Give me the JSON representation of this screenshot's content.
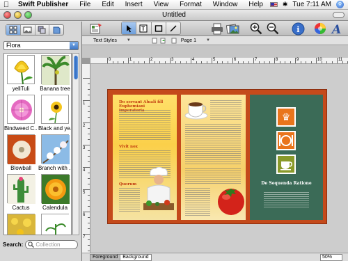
{
  "menubar": {
    "app": "Swift Publisher",
    "items": [
      "File",
      "Edit",
      "Insert",
      "View",
      "Format",
      "Window",
      "Help"
    ],
    "clock": "Tue 7:11 AM"
  },
  "window": {
    "title": "Untitled"
  },
  "subtoolbar": {
    "text_styles": "Text Styles",
    "page": "Page 1"
  },
  "leftpanel": {
    "category": "Flora",
    "clips": [
      {
        "label": "yellTuli"
      },
      {
        "label": "Banana tree"
      },
      {
        "label": "Bindweed C..."
      },
      {
        "label": "Black and ye..."
      },
      {
        "label": "Blowball"
      },
      {
        "label": "Branch with ..."
      },
      {
        "label": "Cactus"
      },
      {
        "label": "Calendula"
      }
    ],
    "search_label": "Search:",
    "search_placeholder": "Collection"
  },
  "ruler": {
    "top": [
      "0",
      "1",
      "2",
      "3",
      "4",
      "5",
      "6",
      "7",
      "8",
      "9",
      "10",
      "11"
    ],
    "left": [
      "1",
      "2",
      "3",
      "4",
      "5",
      "6",
      "7"
    ]
  },
  "brochure": {
    "p1_heading1": "Do servant Aluali fill Euphemiani imperatoria",
    "p1_heading2": "Vivit nox",
    "p1_heading3": "Quorum",
    "p3_title": "De Sequenda Ratione"
  },
  "bottombar": {
    "tabs": [
      "Foreground",
      "Background"
    ],
    "zoom": "50%"
  },
  "colors": {
    "brochure_border": "#c44a1b",
    "panel_green": "#3b6b57",
    "accent_orange": "#e9751c"
  }
}
